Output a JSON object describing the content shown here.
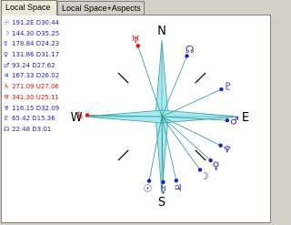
{
  "tabs": [
    {
      "label": "Local Space",
      "active": true
    },
    {
      "label": "Local Space+Aspects",
      "active": false
    }
  ],
  "planets": [
    {
      "symbol": "☉",
      "text": "191.2E D30.44",
      "color": "#1f1fd1"
    },
    {
      "symbol": "☽",
      "text": "144.30 D35.25",
      "color": "#1f1fd1"
    },
    {
      "symbol": "☿",
      "text": "178.84 D24.23",
      "color": "#1f1fd1"
    },
    {
      "symbol": "♀",
      "text": "131.86 D31.17",
      "color": "#1f1fd1"
    },
    {
      "symbol": "♂",
      "text": "93.24 D27.62",
      "color": "#1f1fd1"
    },
    {
      "symbol": "♃",
      "text": "167.33 D26.02",
      "color": "#1f1fd1"
    },
    {
      "symbol": "♄",
      "text": "271.09 U27.06",
      "color": "#e01010"
    },
    {
      "symbol": "♅",
      "text": "341.30 U25.11",
      "color": "#e01010"
    },
    {
      "symbol": "♆",
      "text": "116.15 D32.09",
      "color": "#1f1fd1"
    },
    {
      "symbol": "♇",
      "text": "65.42 D15.36",
      "color": "#1f1fd1"
    },
    {
      "symbol": "☊",
      "text": "22.48 D3.01",
      "color": "#1f1fd1"
    }
  ],
  "compass": {
    "north": "N",
    "south": "S",
    "east": "E",
    "west": "W"
  },
  "colors": {
    "up": "#e01010",
    "down": "#1f1fd1",
    "line": "#2a9d9d",
    "star": "#a8e8ee"
  }
}
